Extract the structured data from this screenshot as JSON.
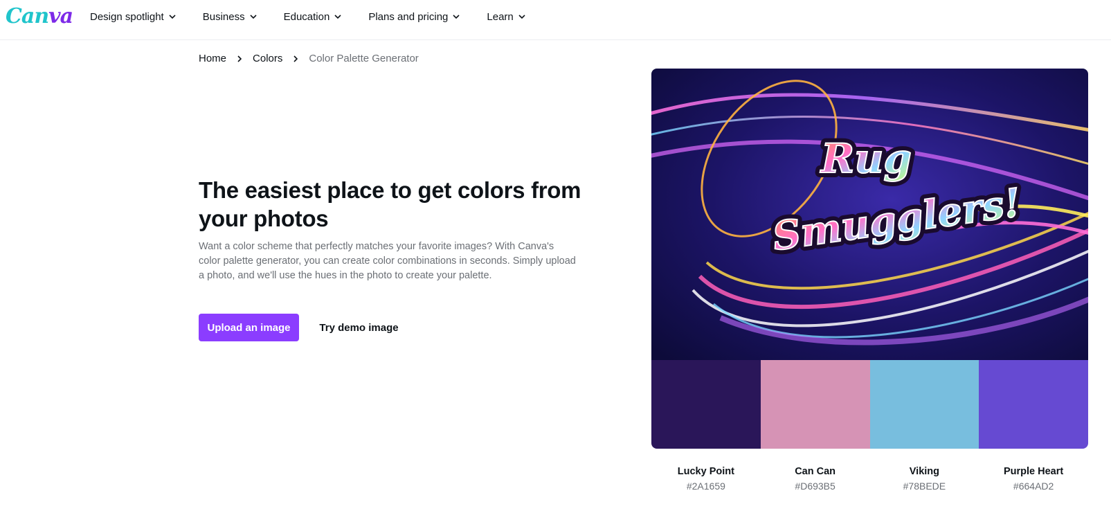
{
  "brand": {
    "logo_text_main": "Can",
    "logo_text_accent": "va",
    "colors": {
      "logo_teal": "#20C4CB",
      "logo_purple": "#7D2AE8",
      "primary_button": "#8B3DFF"
    }
  },
  "nav": {
    "items": [
      {
        "label": "Design spotlight",
        "icon": "chevron-down-icon"
      },
      {
        "label": "Business",
        "icon": "chevron-down-icon"
      },
      {
        "label": "Education",
        "icon": "chevron-down-icon"
      },
      {
        "label": "Plans and pricing",
        "icon": "chevron-down-icon"
      },
      {
        "label": "Learn",
        "icon": "chevron-down-icon"
      }
    ]
  },
  "breadcrumb": {
    "items": [
      "Home",
      "Colors",
      "Color Palette Generator"
    ],
    "separator_icon": "chevron-right-icon"
  },
  "hero": {
    "title": "The easiest place to get colors from your photos",
    "description": "Want a color scheme that perfectly matches your favorite images? With Canva's color palette generator, you can create color combinations in seconds. Simply upload a photo, and we'll use the hues in the photo to create your palette.",
    "upload_button": "Upload an image",
    "demo_button": "Try demo image"
  },
  "palette": {
    "image_text": "Rug Smugglers!",
    "swatches": [
      {
        "name": "Lucky Point",
        "hex": "#2A1659"
      },
      {
        "name": "Can Can",
        "hex": "#D693B5"
      },
      {
        "name": "Viking",
        "hex": "#78BEDE"
      },
      {
        "name": "Purple Heart",
        "hex": "#664AD2"
      }
    ]
  }
}
